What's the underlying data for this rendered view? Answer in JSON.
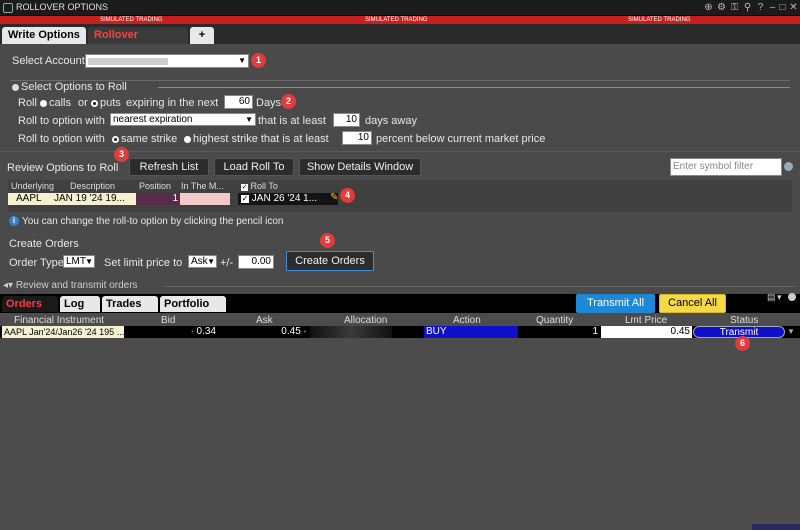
{
  "window": {
    "title": "ROLLOVER OPTIONS",
    "sim_label": "SIMULATED TRADING"
  },
  "tabs": [
    {
      "label": "Write Options"
    },
    {
      "label": "Rollover Options"
    },
    {
      "label": "+"
    }
  ],
  "select_account": {
    "label": "Select Account",
    "value": ""
  },
  "section_select": {
    "label": "Select Options to Roll"
  },
  "roll_row": {
    "roll": "Roll",
    "calls": "calls",
    "or": "or",
    "puts": "puts",
    "expiring": "expiring in the next",
    "days_value": "60",
    "days": "Days"
  },
  "roll_to_row": {
    "prefix": "Roll to option with",
    "dropdown": "nearest expiration",
    "middle": "that is at least",
    "value": "10",
    "suffix": "days away"
  },
  "strike_row": {
    "prefix": "Roll to option with",
    "same": "same strike",
    "highest": "highest strike that is at least",
    "value": "10",
    "suffix": "percent below current market price"
  },
  "review": {
    "label": "Review Options to Roll",
    "refresh": "Refresh List",
    "load": "Load Roll To",
    "show_details": "Show Details Window",
    "filter_placeholder": "Enter symbol filter"
  },
  "review_table": {
    "headers": [
      "Underlying",
      "Description",
      "Position",
      "In The M...",
      "Roll To"
    ],
    "row": {
      "underlying": "AAPL",
      "description": "JAN 19 '24 19...",
      "position": "1",
      "in_the_money": "",
      "roll_to": "JAN 26 '24 1..."
    }
  },
  "info_text": "You can change the roll-to option by clicking the pencil icon",
  "create_orders": {
    "title": "Create Orders",
    "order_type_label": "Order Type",
    "order_type": "LMT",
    "limit_label": "Set limit price to",
    "limit_value": "Ask",
    "plusminus": "+/-",
    "offset": "0.00",
    "button": "Create Orders"
  },
  "review_transmit": "Review and transmit orders",
  "bottom_tabs": [
    {
      "label": "Orders"
    },
    {
      "label": "Log"
    },
    {
      "label": "Trades"
    },
    {
      "label": "Portfolio"
    }
  ],
  "bottom_buttons": {
    "transmit_all": "Transmit All",
    "cancel_all": "Cancel All"
  },
  "orders_table": {
    "headers": [
      "Financial Instrument",
      "Bid",
      "Ask",
      "Allocation",
      "Action",
      "Quantity",
      "Lmt Price",
      "Status"
    ],
    "row": {
      "instrument": "AAPL Jan'24/Jan26 '24 195 ...",
      "bid": "0.34",
      "ask": "0.45",
      "allocation": "",
      "action": "BUY",
      "quantity": "1",
      "lmt_price": "0.45",
      "status": "Transmit"
    }
  },
  "badges": [
    "1",
    "2",
    "3",
    "4",
    "5",
    "6"
  ],
  "colors": {
    "accent_red": "#e23b3b",
    "tab_red": "#ff3b3b",
    "transmit_blue": "#1f88d6",
    "cancel_yellow": "#f5d949",
    "buy_blue": "#1010c8",
    "sim_red": "#c8201e"
  }
}
